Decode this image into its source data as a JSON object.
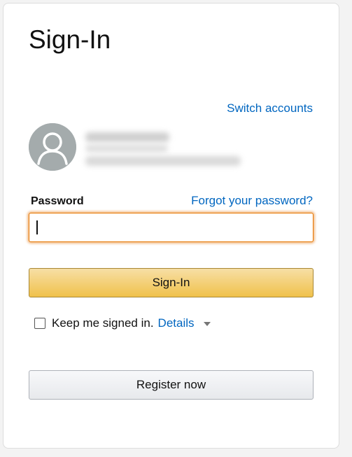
{
  "colors": {
    "link": "#0066c0",
    "primary_button_top": "#f7dfa5",
    "primary_button_bottom": "#f0c14b",
    "focus_border": "#e77600",
    "avatar_bg": "#a4abac"
  },
  "header": {
    "title": "Sign-In"
  },
  "account": {
    "switch_label": "Switch accounts",
    "avatar_icon": "user-avatar-icon",
    "name_redacted": true
  },
  "password": {
    "label": "Password",
    "forgot_label": "Forgot your password?",
    "value": "",
    "placeholder": ""
  },
  "actions": {
    "signin_label": "Sign-In",
    "register_label": "Register now"
  },
  "keep_signed_in": {
    "label": "Keep me signed in.",
    "checked": false,
    "details_label": "Details",
    "details_icon": "caret-down-icon"
  }
}
